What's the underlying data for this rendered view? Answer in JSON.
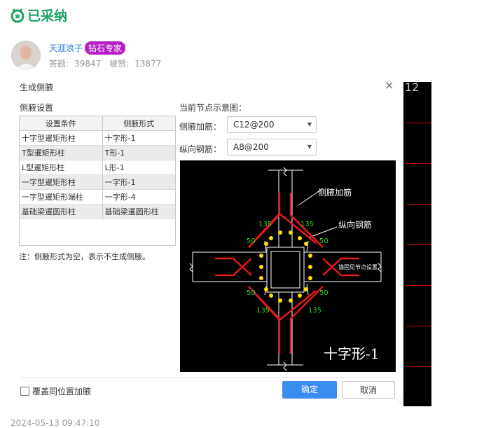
{
  "header": {
    "adopted_label": "已采纳"
  },
  "user": {
    "name": "天涯浪子",
    "badge": "钻石专家",
    "answers_label": "答题:",
    "answers": "39847",
    "likes_label": "被赞:",
    "likes": "13877"
  },
  "timestamp": "2024-05-13 09:47:10",
  "background": {
    "label": "12"
  },
  "dialog": {
    "title": "生成侧腋",
    "close_icon": "×",
    "settings_title": "侧腋设置",
    "table": {
      "headers": [
        "设置条件",
        "侧腋形式"
      ],
      "rows": [
        [
          "十字型暹矩形柱",
          "十字形-1"
        ],
        [
          "T型暹矩形柱",
          "T形-1"
        ],
        [
          "L型暹矩形柱",
          "L形-1"
        ],
        [
          "一字型暹矩形柱",
          "一字形-1"
        ],
        [
          "一字型暹矩形端柱",
          "一字形-4"
        ],
        [
          "基础梁暹圆形柱",
          "基础梁暹圆形柱"
        ]
      ]
    },
    "note": "注：侧腋形式为空，表示不生成侧腋。",
    "diagram_label": "当前节点示意图：",
    "haunch_rebar": {
      "label": "侧腋加筋：",
      "value": "C12@200"
    },
    "long_rebar": {
      "label": "纵向钢筋：",
      "value": "A8@200"
    },
    "diagram": {
      "label_haunch": "侧腋加筋",
      "label_long": "纵向钢筋",
      "label_anchor": "锚固见节点设置",
      "dim_135": "135",
      "dim_50": "50",
      "caption": "十字形-1"
    },
    "overwrite_label": "覆盖同位置加腋",
    "ok_label": "确定",
    "cancel_label": "取消"
  }
}
